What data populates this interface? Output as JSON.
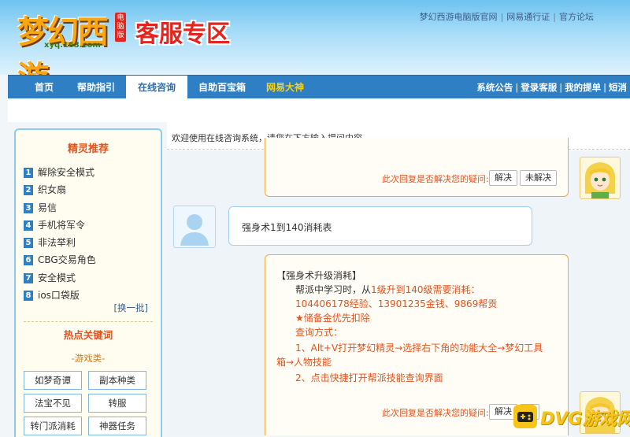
{
  "header": {
    "logo_text": "梦幻西游",
    "logo_tag": "电脑版",
    "logo_url": "xyq.163.com",
    "title": "客服专区",
    "links": [
      "梦幻西游电脑版官网",
      "网易通行证",
      "官方论坛"
    ]
  },
  "nav": {
    "items": [
      "首页",
      "帮助指引",
      "在线咨询",
      "自助百宝箱",
      "网易大神"
    ],
    "active": "在线咨询",
    "right_links": [
      "系统公告",
      "登录客服",
      "我的提单",
      "短消"
    ]
  },
  "sidebar": {
    "title": "精灵推荐",
    "items": [
      {
        "num": "1",
        "label": "解除安全模式"
      },
      {
        "num": "2",
        "label": "织女扇"
      },
      {
        "num": "3",
        "label": "易信"
      },
      {
        "num": "4",
        "label": "手机将军令"
      },
      {
        "num": "5",
        "label": "非法举利"
      },
      {
        "num": "6",
        "label": "CBG交易角色"
      },
      {
        "num": "7",
        "label": "安全模式"
      },
      {
        "num": "8",
        "label": "ios口袋版"
      }
    ],
    "refresh": "[换一批]",
    "hot_title": "热点关键词",
    "hot_subtitle": "-游戏类-",
    "keywords": [
      "如梦奇谭",
      "副本种类",
      "法宝不见",
      "转服",
      "转门派消耗",
      "神器任务"
    ]
  },
  "main": {
    "welcome": "欢迎使用在线咨询系统，请您在下方输入提问内容。",
    "feedback_question": "此次回复是否解决您的疑问:",
    "btn_solved": "解决",
    "btn_unsolved": "未解决",
    "user_message": "强身术1到140消耗表",
    "answer": {
      "heading": "【强身术升级消耗】",
      "line1_prefix": "帮派中学习时，从",
      "line1_highlight": "1级升到140级需要消耗：",
      "line2": "104406178经验、13901235金钱、9869帮贡",
      "line3": "★储备金优先扣除",
      "line4": "查询方式：",
      "line5": "1、Alt+V打开梦幻精灵→选择右下角的功能大全→梦幻工具",
      "line6": "箱→人物技能",
      "line7": "2、点击快捷打开帮派技能查询界面"
    },
    "btn_solved_2": "解决",
    "btn_unsolved_2": "解"
  },
  "watermark": "DVG游戏网",
  "colors": {
    "accent_blue": "#2f7fc5",
    "accent_red": "#e2261f",
    "answer_orange": "#e2531f",
    "bubble_border_orange": "#f4a640"
  }
}
